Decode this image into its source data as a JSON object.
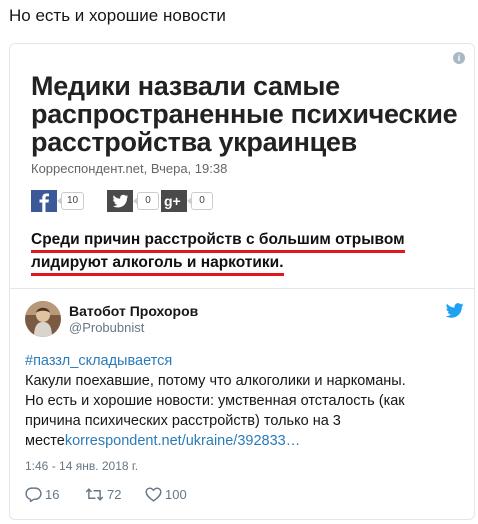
{
  "page": {
    "title": "Но есть и хорошие новости"
  },
  "embed": {
    "info_icon": "i",
    "headline": "Медики назвали самые распространенные психические расстройства украинцев",
    "source": "Корреспондент.net, Вчера, 19:38",
    "shares": [
      {
        "network": "facebook-icon",
        "glyph": "f",
        "count": "10"
      },
      {
        "network": "twitter-icon",
        "glyph": "t",
        "count": "0"
      },
      {
        "network": "google-plus-icon",
        "glyph": "g+",
        "count": "0"
      }
    ],
    "quote_lines": [
      "Среди причин расстройств с большим отрывом",
      "лидируют алкоголь и наркотики."
    ],
    "underline_color": "#e0161d"
  },
  "tweet": {
    "display_name": "Ватобот Прохоров",
    "handle": "@Probubnist",
    "hashtag": "#паззл_складывается",
    "text_lines": [
      "Какули поехавшие, потому что алкоголики и наркоманы.",
      "Но есть и хорошие новости: умственная отсталость (как",
      "причина психических расстройств) только на 3"
    ],
    "last_line_prefix": "месте",
    "link": "korrespondent.net/ukraine/392833…",
    "timestamp": "1:46 - 14 янв. 2018 г.",
    "actions": {
      "replies": "16",
      "retweets": "72",
      "likes": "100"
    },
    "link_color": "#2b7bb9",
    "bird_color": "#1da1f2"
  }
}
